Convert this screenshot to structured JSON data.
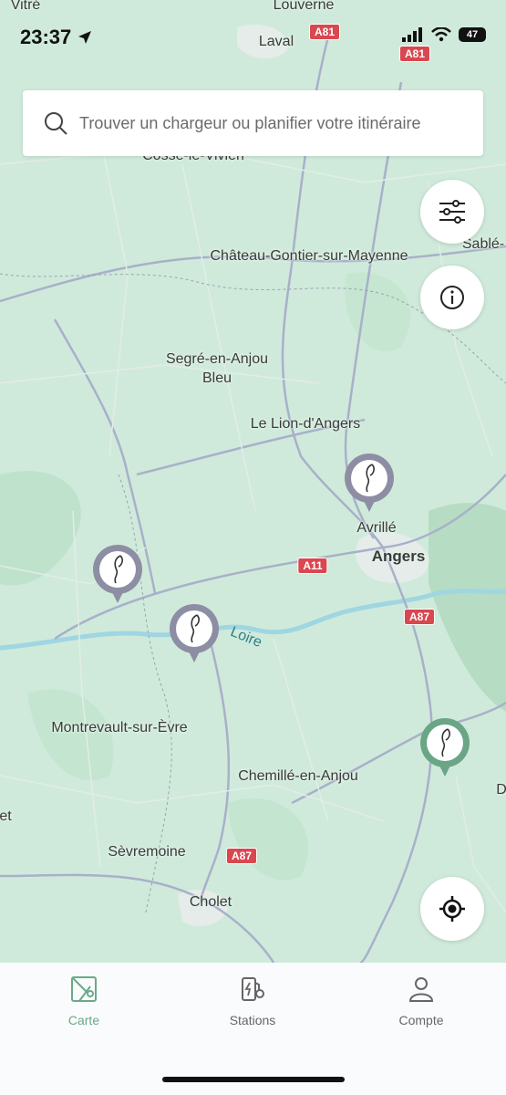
{
  "status_bar": {
    "time": "23:37",
    "battery": "47"
  },
  "search": {
    "placeholder": "Trouver un chargeur ou planifier votre itinéraire"
  },
  "map": {
    "places": [
      {
        "name": "Vitré"
      },
      {
        "name": "Louverne"
      },
      {
        "name": "Laval"
      },
      {
        "name": "Cossé-le-Vivien"
      },
      {
        "name": "Sablé-"
      },
      {
        "name": "Château-Gontier-sur-Mayenne"
      },
      {
        "name": "Segré-en-Anjou"
      },
      {
        "name": "Bleu"
      },
      {
        "name": "Le Lion-d'Angers"
      },
      {
        "name": "Avrillé"
      },
      {
        "name": "Angers"
      },
      {
        "name": "Montrevault-sur-Èvre"
      },
      {
        "name": "Chemillé-en-Anjou"
      },
      {
        "name": "Sèvremoine"
      },
      {
        "name": "Cholet"
      },
      {
        "name": "et"
      },
      {
        "name": "D"
      }
    ],
    "roads": [
      "A81",
      "A81",
      "A11",
      "A87",
      "A87"
    ],
    "river": "Loire"
  },
  "tabs": [
    {
      "label": "Carte",
      "icon": "map-icon"
    },
    {
      "label": "Stations",
      "icon": "charging-station-icon"
    },
    {
      "label": "Compte",
      "icon": "user-icon"
    }
  ],
  "colors": {
    "accent": "#6aaa88",
    "pin_grey": "#8d8ea3",
    "pin_green": "#6aa586",
    "map_bg": "#cfeadb"
  }
}
